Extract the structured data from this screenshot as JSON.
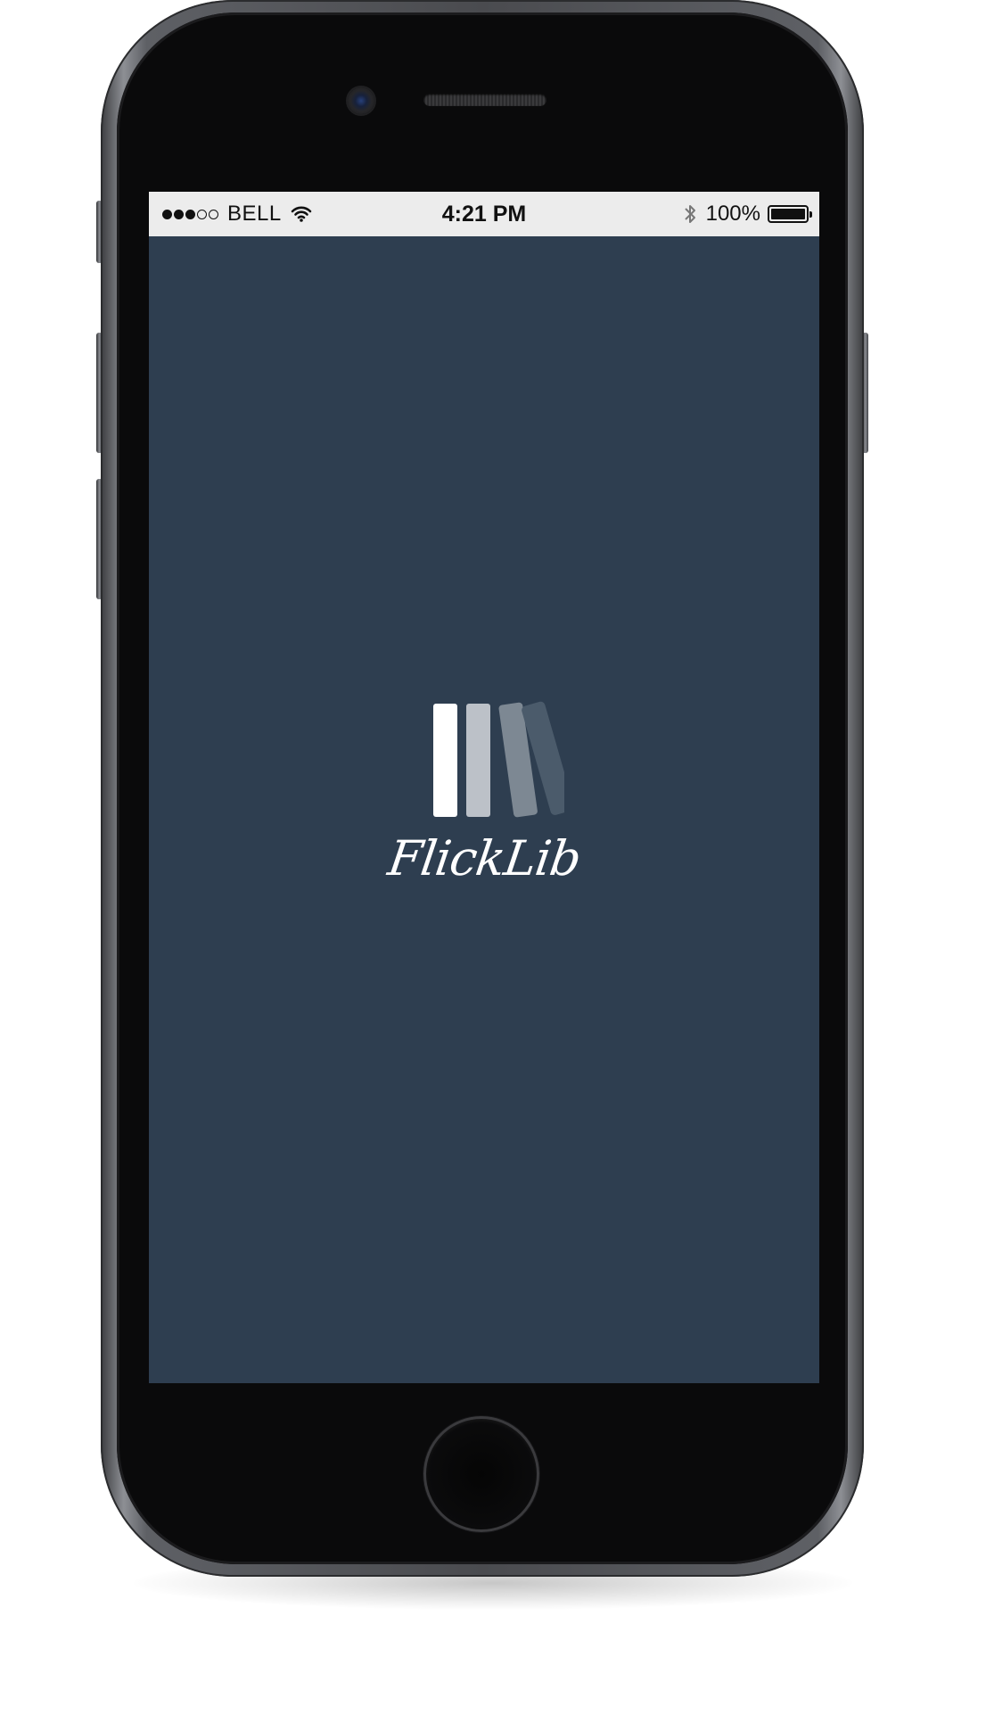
{
  "status_bar": {
    "signal_filled": 3,
    "signal_total": 5,
    "carrier": "BELL",
    "wifi_icon": "wifi-icon",
    "time": "4:21 PM",
    "bluetooth_icon": "bluetooth-icon",
    "battery_percent_label": "100%",
    "battery_level": 1.0
  },
  "splash": {
    "logo_icon": "books-logo-icon",
    "app_name": "FlickLib",
    "background_color": "#2e3e50",
    "book_colors": [
      "#ffffff",
      "#bcc1c8",
      "#7d8893",
      "#4b5b6b"
    ]
  },
  "device": {
    "home_button_icon": "home-button",
    "front_camera_icon": "camera-icon",
    "speaker_icon": "speaker-grille"
  }
}
